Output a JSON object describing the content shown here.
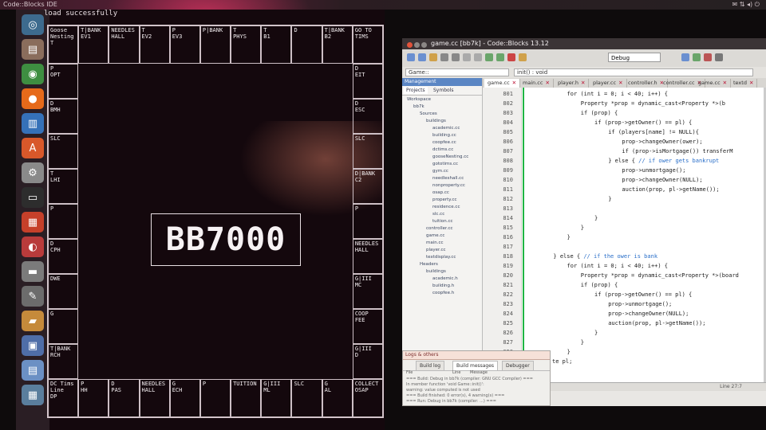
{
  "system": {
    "window_title": "Code::Blocks IDE",
    "terminal_message": "load successfully"
  },
  "launcher": {
    "items": [
      {
        "name": "ubuntu-dash",
        "glyph": "◎",
        "color": "#3d6b8e"
      },
      {
        "name": "files",
        "glyph": "▤",
        "color": "#8a6d5c"
      },
      {
        "name": "chrome",
        "glyph": "◉",
        "color": "#3e8e41"
      },
      {
        "name": "firefox",
        "glyph": "●",
        "color": "#e66a1a"
      },
      {
        "name": "libreoffice-writer",
        "glyph": "▥",
        "color": "#3571b8"
      },
      {
        "name": "software-center",
        "glyph": "A",
        "color": "#d8582a"
      },
      {
        "name": "system-settings",
        "glyph": "⚙",
        "color": "#8a8a8a"
      },
      {
        "name": "terminal",
        "glyph": "▭",
        "color": "#2d2d2d"
      },
      {
        "name": "codeblocks",
        "glyph": "▦",
        "color": "#c6402a"
      },
      {
        "name": "recorder",
        "glyph": "◐",
        "color": "#b93b3b"
      },
      {
        "name": "disk",
        "glyph": "▬",
        "color": "#7b7b7b"
      },
      {
        "name": "editor",
        "glyph": "✎",
        "color": "#6c6c6c"
      },
      {
        "name": "folder",
        "glyph": "▰",
        "color": "#c58a3b"
      },
      {
        "name": "app-blue",
        "glyph": "▣",
        "color": "#4f6ea8"
      },
      {
        "name": "app-lightblue",
        "glyph": "▤",
        "color": "#6b90c4"
      },
      {
        "name": "workspace",
        "glyph": "▦",
        "color": "#5a7e9d"
      }
    ]
  },
  "board": {
    "top_row": [
      {
        "l1": "Goose",
        "l2": "Nesting",
        "l3": "T"
      },
      {
        "l1": "T|BANK",
        "l2": "EV1",
        "l3": ""
      },
      {
        "l1": "NEEDLES",
        "l2": "HALL",
        "l3": ""
      },
      {
        "l1": "T",
        "l2": "EV2",
        "l3": ""
      },
      {
        "l1": "P",
        "l2": "EV3",
        "l3": ""
      },
      {
        "l1": "P|BANK",
        "l2": "",
        "l3": ""
      },
      {
        "l1": "T",
        "l2": "PHYS",
        "l3": ""
      },
      {
        "l1": "T",
        "l2": "B1",
        "l3": ""
      },
      {
        "l1": "D",
        "l2": "",
        "l3": ""
      },
      {
        "l1": "T|BANK",
        "l2": "B2",
        "l3": ""
      },
      {
        "l1": "GO TO",
        "l2": "TIMS",
        "l3": ""
      }
    ],
    "left_col": [
      {
        "l1": "P",
        "l2": "OPT"
      },
      {
        "l1": "D",
        "l2": "BMH"
      },
      {
        "l1": "SLC",
        "l2": ""
      },
      {
        "l1": "T",
        "l2": "LHI"
      },
      {
        "l1": "P",
        "l2": ""
      },
      {
        "l1": "D",
        "l2": "CPH"
      },
      {
        "l1": "DWE",
        "l2": ""
      },
      {
        "l1": "G",
        "l2": ""
      },
      {
        "l1": "T|BANK",
        "l2": "RCH"
      }
    ],
    "right_col": [
      {
        "l1": "D",
        "l2": "EIT"
      },
      {
        "l1": "D",
        "l2": "ESC"
      },
      {
        "l1": "SLC",
        "l2": ""
      },
      {
        "l1": "D|BANK",
        "l2": "C2"
      },
      {
        "l1": "P",
        "l2": ""
      },
      {
        "l1": "NEEDLES",
        "l2": "HALL"
      },
      {
        "l1": "G|III",
        "l2": "MC"
      },
      {
        "l1": "COOP",
        "l2": "FEE"
      },
      {
        "l1": "G|III",
        "l2": "D"
      }
    ],
    "bottom_row": [
      {
        "l1": "DC Tims",
        "l2": "Line",
        "l3": "DP"
      },
      {
        "l1": "P",
        "l2": "",
        "l3": "HH"
      },
      {
        "l1": "D",
        "l2": "",
        "l3": "PAS"
      },
      {
        "l1": "NEEDLES",
        "l2": "HALL",
        "l3": ""
      },
      {
        "l1": "G",
        "l2": "",
        "l3": "ECH"
      },
      {
        "l1": "P",
        "l2": "",
        "l3": ""
      },
      {
        "l1": "TUITION",
        "l2": "",
        "l3": ""
      },
      {
        "l1": "G|III",
        "l2": "",
        "l3": "ML"
      },
      {
        "l1": "SLC",
        "l2": "",
        "l3": ""
      },
      {
        "l1": "G",
        "l2": "",
        "l3": "AL"
      },
      {
        "l1": "COLLECT",
        "l2": "OSAP",
        "l3": ""
      }
    ],
    "center_logo": "BB7000"
  },
  "codeblocks": {
    "title": "game.cc [bb7k] - Code::Blocks 13.12",
    "build_target": "Debug",
    "scope_left": "Game::",
    "scope_right": "init() : void",
    "management_header": "Management",
    "management_tabs": [
      "Projects",
      "Symbols"
    ],
    "tree": [
      {
        "depth": 0,
        "label": "Workspace"
      },
      {
        "depth": 1,
        "label": "bb7k"
      },
      {
        "depth": 2,
        "label": "Sources"
      },
      {
        "depth": 3,
        "label": "buildings"
      },
      {
        "depth": 4,
        "label": "academic.cc"
      },
      {
        "depth": 4,
        "label": "building.cc"
      },
      {
        "depth": 4,
        "label": "coopfee.cc"
      },
      {
        "depth": 4,
        "label": "dctims.cc"
      },
      {
        "depth": 4,
        "label": "gooseNesting.cc"
      },
      {
        "depth": 4,
        "label": "gototims.cc"
      },
      {
        "depth": 4,
        "label": "gym.cc"
      },
      {
        "depth": 4,
        "label": "needleshall.cc"
      },
      {
        "depth": 4,
        "label": "nonproperty.cc"
      },
      {
        "depth": 4,
        "label": "osap.cc"
      },
      {
        "depth": 4,
        "label": "property.cc"
      },
      {
        "depth": 4,
        "label": "residence.cc"
      },
      {
        "depth": 4,
        "label": "slc.cc"
      },
      {
        "depth": 4,
        "label": "tuition.cc"
      },
      {
        "depth": 3,
        "label": "controller.cc"
      },
      {
        "depth": 3,
        "label": "game.cc"
      },
      {
        "depth": 3,
        "label": "main.cc"
      },
      {
        "depth": 3,
        "label": "player.cc"
      },
      {
        "depth": 3,
        "label": "textdisplay.cc"
      },
      {
        "depth": 2,
        "label": "Headers"
      },
      {
        "depth": 3,
        "label": "buildings"
      },
      {
        "depth": 4,
        "label": "academic.h"
      },
      {
        "depth": 4,
        "label": "building.h"
      },
      {
        "depth": 4,
        "label": "coopfee.h"
      }
    ],
    "tabs": [
      {
        "label": "game.cc",
        "active": true
      },
      {
        "label": "main.cc",
        "active": false
      },
      {
        "label": "player.h",
        "active": false
      },
      {
        "label": "player.cc",
        "active": false
      },
      {
        "label": "controller.h",
        "active": false
      },
      {
        "label": "controller.cc",
        "active": false
      },
      {
        "label": "game.cc",
        "active": false
      },
      {
        "label": "textd",
        "active": false
      }
    ],
    "lines": [
      {
        "n": "801",
        "indent": 12,
        "code": "for (int i = 0; i < 40; i++) {"
      },
      {
        "n": "802",
        "indent": 16,
        "code": "Property *prop = dynamic_cast<Property *>(b"
      },
      {
        "n": "803",
        "indent": 16,
        "code": "if (prop) {"
      },
      {
        "n": "804",
        "indent": 20,
        "code": "if (prop->getOwner() == pl) {"
      },
      {
        "n": "805",
        "indent": 24,
        "code": "if (players[name] != NULL){"
      },
      {
        "n": "806",
        "indent": 28,
        "code": "prop->changeOwner(ower);"
      },
      {
        "n": "807",
        "indent": 28,
        "code": "if (prop->isMortgage()) transferM"
      },
      {
        "n": "808",
        "indent": 24,
        "code": "} else { // if ower gets bankrupt"
      },
      {
        "n": "809",
        "indent": 28,
        "code": "prop->unmortgage();"
      },
      {
        "n": "810",
        "indent": 28,
        "code": "prop->changeOwner(NULL);"
      },
      {
        "n": "811",
        "indent": 28,
        "code": "auction(prop, pl->getName());"
      },
      {
        "n": "812",
        "indent": 24,
        "code": "}"
      },
      {
        "n": "813",
        "indent": 0,
        "code": ""
      },
      {
        "n": "814",
        "indent": 20,
        "code": "}"
      },
      {
        "n": "815",
        "indent": 16,
        "code": "}"
      },
      {
        "n": "816",
        "indent": 12,
        "code": "}"
      },
      {
        "n": "817",
        "indent": 0,
        "code": ""
      },
      {
        "n": "818",
        "indent": 8,
        "code": "} else { // if the ower is bank"
      },
      {
        "n": "819",
        "indent": 12,
        "code": "for (int i = 0; i < 40; i++) {"
      },
      {
        "n": "820",
        "indent": 16,
        "code": "Property *prop = dynamic_cast<Property *>(board"
      },
      {
        "n": "821",
        "indent": 16,
        "code": "if (prop) {"
      },
      {
        "n": "822",
        "indent": 20,
        "code": "if (prop->getOwner() == pl) {"
      },
      {
        "n": "823",
        "indent": 24,
        "code": "prop->unmortgage();"
      },
      {
        "n": "824",
        "indent": 24,
        "code": "prop->changeOwner(NULL);"
      },
      {
        "n": "825",
        "indent": 24,
        "code": "auction(prop, pl->getName());"
      },
      {
        "n": "826",
        "indent": 20,
        "code": "}"
      },
      {
        "n": "827",
        "indent": 16,
        "code": "}"
      },
      {
        "n": "828",
        "indent": 12,
        "code": "}"
      },
      {
        "n": "829",
        "indent": 0,
        "code": ""
      }
    ],
    "logs_header": "Logs & others",
    "logs_tabs": [
      "Build log",
      "Build messages",
      "Debugger"
    ],
    "logs_cols": [
      "File",
      "Line",
      "Message"
    ],
    "log_lines": [
      "=== Build: Debug in bb7k (compiler: GNU GCC Compiler) ===",
      "In member function 'void Game::init()':",
      "warning: value computed is not used",
      "=== Build finished: 0 error(s), 4 warning(s) ===",
      "=== Run: Debug in bb7k (compiler: ...) ==="
    ],
    "code_tail": "te pl;",
    "status_right": "Line 27:7"
  }
}
